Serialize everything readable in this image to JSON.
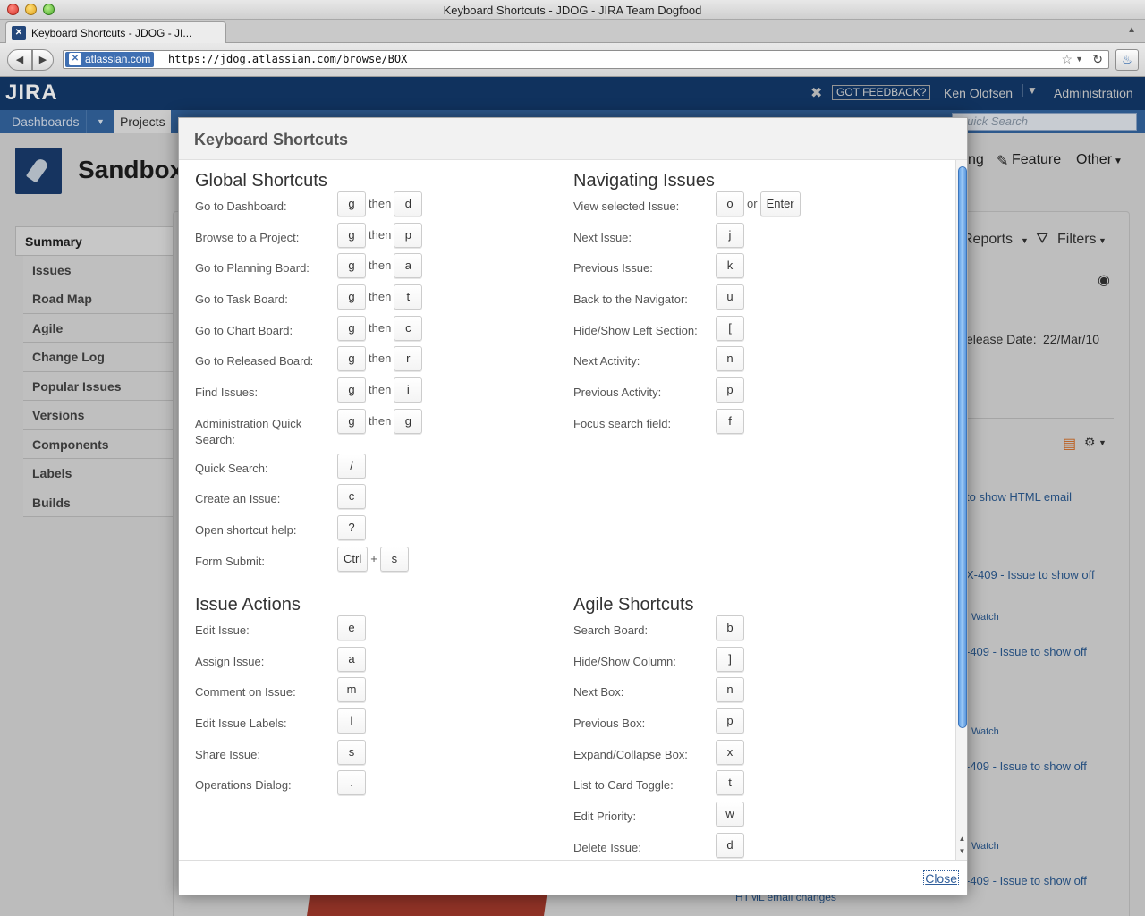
{
  "browser": {
    "window_title": "Keyboard Shortcuts - JDOG - JIRA Team Dogfood",
    "tab_label": "Keyboard Shortcuts - JDOG - JI...",
    "identity_label": "atlassian.com",
    "url": "https://jdog.atlassian.com/browse/BOX"
  },
  "jira": {
    "logo": "JIRA",
    "feedback": "GOT FEEDBACK?",
    "user": "Ken Olofsen",
    "admin": "Administration",
    "menu": {
      "dashboards": "Dashboards",
      "projects": "Projects",
      "quick_search_placeholder": "Quick Search"
    },
    "project_title": "Sandbox",
    "right_tabs": {
      "ng": "ng",
      "feature": "Feature",
      "other": "Other"
    },
    "sidebar": [
      "Summary",
      "Issues",
      "Road Map",
      "Agile",
      "Change Log",
      "Popular Issues",
      "Versions",
      "Components",
      "Labels",
      "Builds"
    ],
    "panel": {
      "reports": "Reports",
      "filters": "Filters",
      "release_label": "elease Date:",
      "release_value": "22/Mar/10",
      "activity_1": "to show HTML email",
      "activity_2": "X-409 - Issue to show off",
      "watch": "Watch",
      "activity_3": "-409 - Issue to show off",
      "activity_4": "-409 - Issue to show off",
      "activity_5": "-409 - Issue to show off",
      "activity_6": "HTML email changes"
    }
  },
  "dialog": {
    "title": "Keyboard Shortcuts",
    "close_label": "Close",
    "sections": {
      "global": {
        "title": "Global Shortcuts",
        "rows": [
          {
            "label": "Go to Dashboard:",
            "keys": [
              "g",
              "then",
              "d"
            ]
          },
          {
            "label": "Browse to a Project:",
            "keys": [
              "g",
              "then",
              "p"
            ]
          },
          {
            "label": "Go to Planning Board:",
            "keys": [
              "g",
              "then",
              "a"
            ]
          },
          {
            "label": "Go to Task Board:",
            "keys": [
              "g",
              "then",
              "t"
            ]
          },
          {
            "label": "Go to Chart Board:",
            "keys": [
              "g",
              "then",
              "c"
            ]
          },
          {
            "label": "Go to Released Board:",
            "keys": [
              "g",
              "then",
              "r"
            ]
          },
          {
            "label": "Find Issues:",
            "keys": [
              "g",
              "then",
              "i"
            ]
          },
          {
            "label": "Administration Quick Search:",
            "keys": [
              "g",
              "then",
              "g"
            ]
          },
          {
            "label": "Quick Search:",
            "keys": [
              "/"
            ]
          },
          {
            "label": "Create an Issue:",
            "keys": [
              "c"
            ]
          },
          {
            "label": "Open shortcut help:",
            "keys": [
              "?"
            ]
          },
          {
            "label": "Form Submit:",
            "keys": [
              "Ctrl",
              "+",
              "s"
            ]
          }
        ]
      },
      "navigating": {
        "title": "Navigating Issues",
        "rows": [
          {
            "label": "View selected Issue:",
            "keys": [
              "o",
              "or",
              "Enter"
            ]
          },
          {
            "label": "Next Issue:",
            "keys": [
              "j"
            ]
          },
          {
            "label": "Previous Issue:",
            "keys": [
              "k"
            ]
          },
          {
            "label": "Back to the Navigator:",
            "keys": [
              "u"
            ]
          },
          {
            "label": "Hide/Show Left Section:",
            "keys": [
              "["
            ]
          },
          {
            "label": "Next Activity:",
            "keys": [
              "n"
            ]
          },
          {
            "label": "Previous Activity:",
            "keys": [
              "p"
            ]
          },
          {
            "label": "Focus search field:",
            "keys": [
              "f"
            ]
          }
        ]
      },
      "issue_actions": {
        "title": "Issue Actions",
        "rows": [
          {
            "label": "Edit Issue:",
            "keys": [
              "e"
            ]
          },
          {
            "label": "Assign Issue:",
            "keys": [
              "a"
            ]
          },
          {
            "label": "Comment on Issue:",
            "keys": [
              "m"
            ]
          },
          {
            "label": "Edit Issue Labels:",
            "keys": [
              "l"
            ]
          },
          {
            "label": "Share Issue:",
            "keys": [
              "s"
            ]
          },
          {
            "label": "Operations Dialog:",
            "keys": [
              "."
            ]
          }
        ]
      },
      "agile": {
        "title": "Agile Shortcuts",
        "rows": [
          {
            "label": "Search Board:",
            "keys": [
              "b"
            ]
          },
          {
            "label": "Hide/Show Column:",
            "keys": [
              "]"
            ]
          },
          {
            "label": "Next Box:",
            "keys": [
              "n"
            ]
          },
          {
            "label": "Previous Box:",
            "keys": [
              "p"
            ]
          },
          {
            "label": "Expand/Collapse Box:",
            "keys": [
              "x"
            ]
          },
          {
            "label": "List to Card Toggle:",
            "keys": [
              "t"
            ]
          },
          {
            "label": "Edit Priority:",
            "keys": [
              "w"
            ]
          },
          {
            "label": "Delete Issue:",
            "keys": [
              "d"
            ]
          }
        ]
      }
    }
  },
  "icons": {
    "back": "back-arrow-icon",
    "forward": "forward-arrow-icon",
    "bookmark": "star-icon",
    "reload": "reload-icon",
    "rss": "rss-feed-icon",
    "gear": "gear-icon",
    "eye": "watch-eye-icon"
  }
}
